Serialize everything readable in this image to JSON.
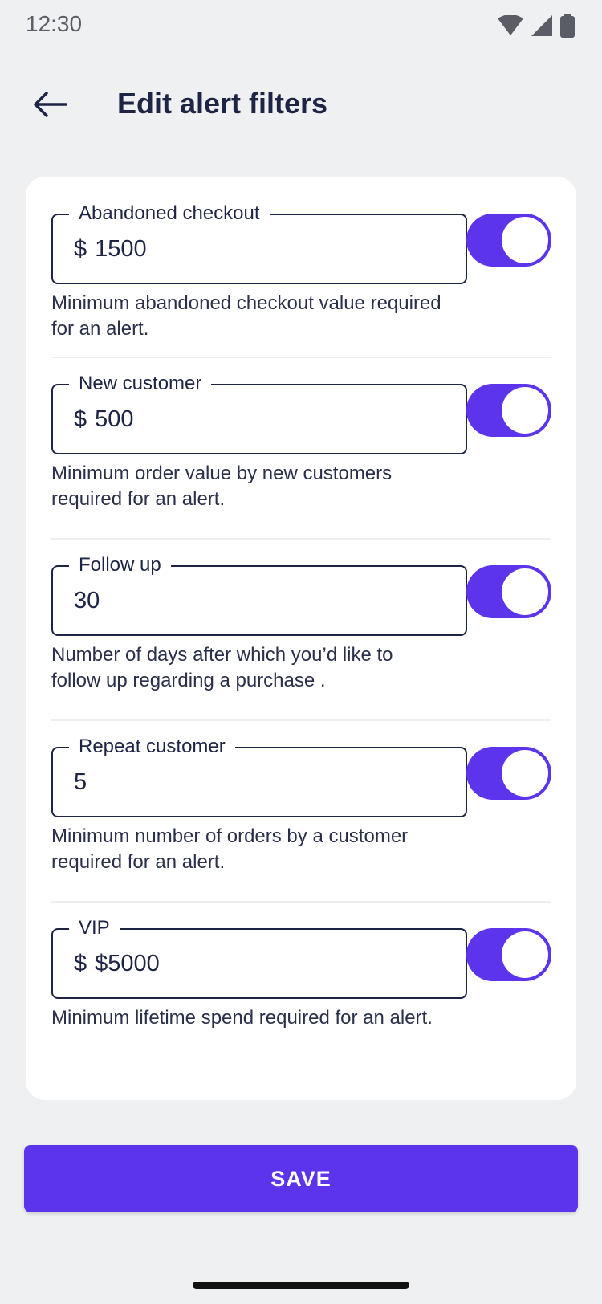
{
  "status_bar": {
    "time": "12:30",
    "icons": [
      "wifi-icon",
      "cell-signal-icon",
      "battery-icon"
    ]
  },
  "header": {
    "title": "Edit alert filters",
    "back_icon": "arrow-left-icon"
  },
  "filters": [
    {
      "label": "Abandoned checkout",
      "prefix": "$",
      "value": "1500",
      "helper": "Minimum abandoned checkout value required for an alert.",
      "enabled": true
    },
    {
      "label": "New customer",
      "prefix": "$",
      "value": "500",
      "helper": "Minimum order value by new customers required for an alert.",
      "enabled": true
    },
    {
      "label": "Follow up",
      "prefix": "",
      "value": "30",
      "helper": "Number of days after which you’d like to follow up regarding a purchase .",
      "enabled": true
    },
    {
      "label": "Repeat customer",
      "prefix": "",
      "value": "5",
      "helper": "Minimum number of orders by a customer required for an alert.",
      "enabled": true
    },
    {
      "label": "VIP",
      "prefix": "$",
      "value": "$5000",
      "helper": "Minimum lifetime spend required for an alert.",
      "enabled": true
    }
  ],
  "save_label": "SAVE",
  "colors": {
    "accent": "#5b34ec",
    "text": "#1e2444",
    "background": "#eff0f2",
    "card": "#ffffff"
  }
}
